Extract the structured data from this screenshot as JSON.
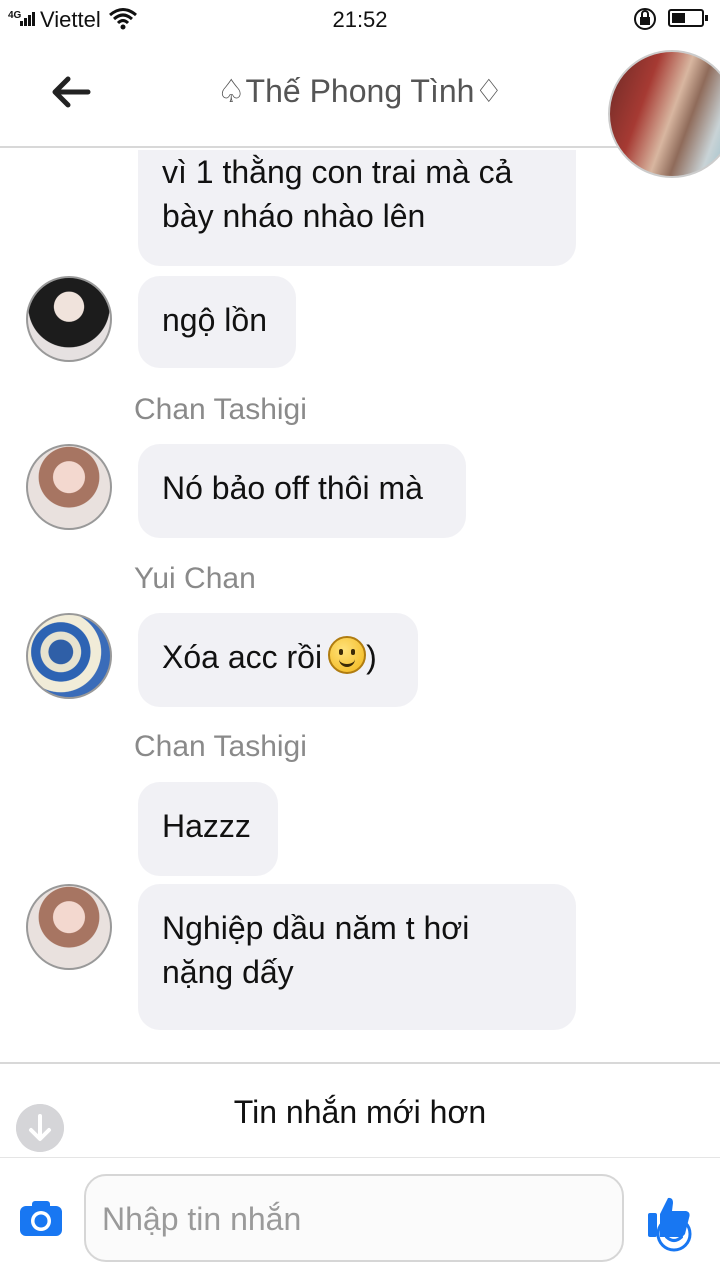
{
  "status_bar": {
    "network": "4G",
    "carrier": "Viettel",
    "time": "21:52",
    "battery_level": 0.45
  },
  "header": {
    "title": "♤Thế Phong Tình♢"
  },
  "messages": [
    {
      "sender": "",
      "text": "vì 1 thằng con trai mà cả\nbày nháo nhào lên"
    },
    {
      "sender": "",
      "text": "ngộ lồn"
    },
    {
      "sender": "Chan Tashigi",
      "text": "Nó bảo off thôi mà"
    },
    {
      "sender": "Yui Chan",
      "text": "Xóa acc rồi",
      "suffix": ")"
    },
    {
      "sender": "Chan Tashigi",
      "text": "Hazzz"
    },
    {
      "sender": "",
      "text": "Nghiệp dầu năm t hơi\nnặng dấy"
    }
  ],
  "newer_bar": {
    "label": "Tin nhắn mới hơn"
  },
  "composer": {
    "placeholder": "Nhập tin nhắn"
  },
  "colors": {
    "accent": "#1877f2",
    "bubble": "#f1f1f5",
    "sender_name": "#8a8a8a"
  },
  "icons": [
    "back-arrow-icon",
    "camera-icon",
    "smiley-icon",
    "thumbs-up-icon",
    "down-arrow-icon",
    "wifi-icon",
    "lock-rotation-icon",
    "battery-icon"
  ]
}
